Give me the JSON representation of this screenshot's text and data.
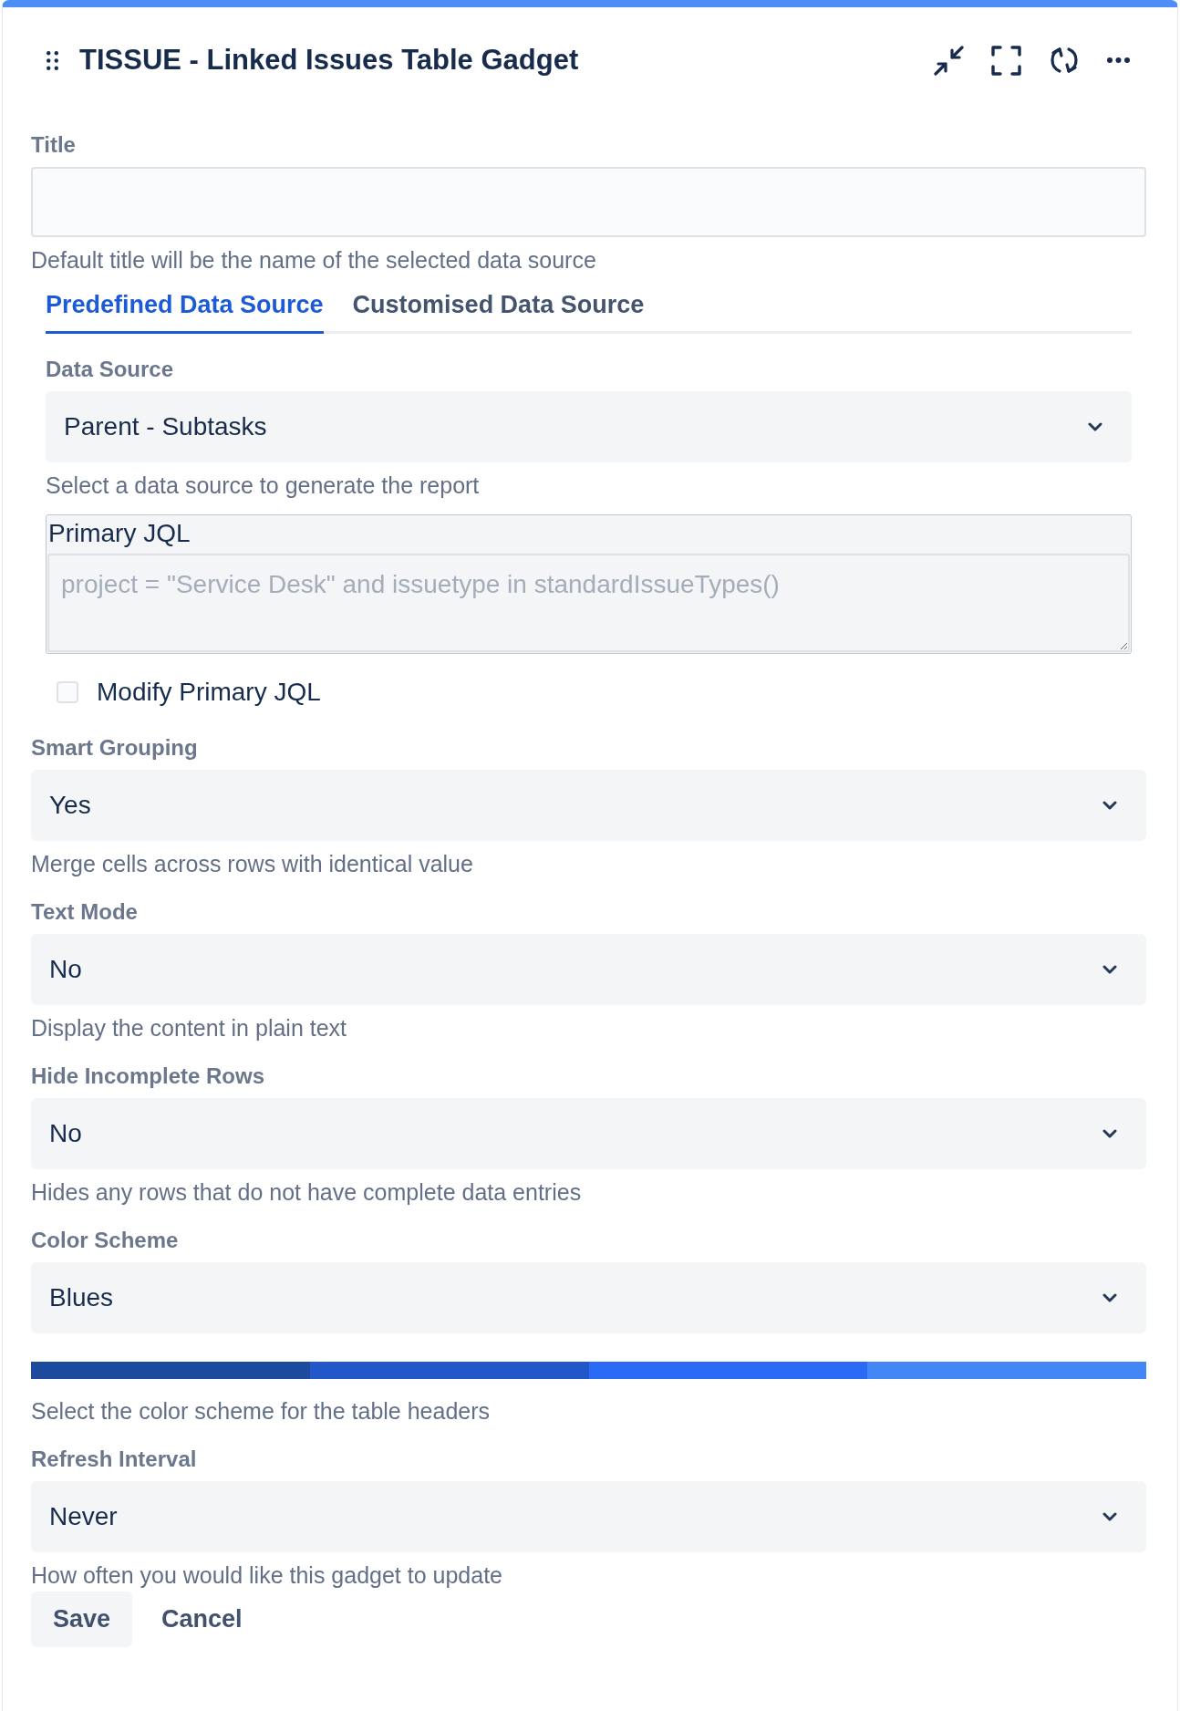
{
  "header": {
    "title": "TISSUE - Linked Issues Table Gadget"
  },
  "title_field": {
    "label": "Title",
    "hint": "Default title will be the name of the selected data source"
  },
  "tabs": [
    {
      "label": "Predefined Data Source",
      "selected": true
    },
    {
      "label": "Customised Data Source",
      "selected": false
    }
  ],
  "data_source": {
    "label": "Data Source",
    "value": "Parent - Subtasks",
    "hint": "Select a data source to generate the report"
  },
  "primary_jql": {
    "label": "Primary JQL",
    "placeholder": "project = \"Service Desk\" and issuetype in standardIssueTypes()"
  },
  "modify_jql": {
    "label": "Modify Primary JQL",
    "checked": false
  },
  "settings": [
    {
      "label": "Smart Grouping",
      "value": "Yes",
      "hint": "Merge cells across rows with identical value"
    },
    {
      "label": "Text Mode",
      "value": "No",
      "hint": "Display the content in plain text"
    },
    {
      "label": "Hide Incomplete Rows",
      "value": "No",
      "hint": "Hides any rows that do not have complete data entries"
    },
    {
      "label": "Color Scheme",
      "value": "Blues",
      "swatches": [
        {
          "color": "#1e4a9e"
        },
        {
          "color": "#2157c8"
        },
        {
          "color": "#2a6af5"
        },
        {
          "color": "#4386f5"
        }
      ],
      "hint": "Select the color scheme for the table headers"
    },
    {
      "label": "Refresh Interval",
      "value": "Never",
      "hint": "How often you would like this gadget to update"
    }
  ],
  "buttons": [
    {
      "label": "Save",
      "kind": "default"
    },
    {
      "label": "Cancel",
      "kind": "subtle"
    }
  ]
}
